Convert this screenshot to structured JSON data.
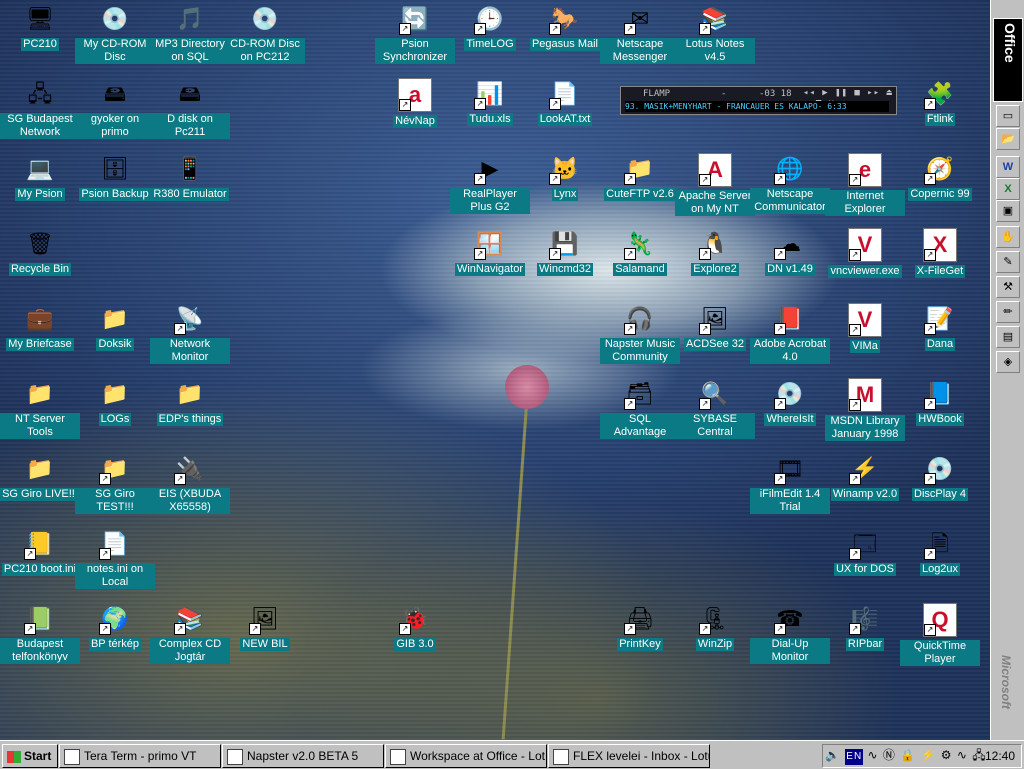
{
  "desktop": {
    "icons": [
      {
        "label": "PC210",
        "glyph": "🖥",
        "shortcut": false,
        "icon": "computer-icon"
      },
      {
        "label": "My CD-ROM Disc",
        "glyph": "💿",
        "shortcut": false,
        "icon": "cd-icon"
      },
      {
        "label": "MP3 Directory on SQL",
        "glyph": "🎵",
        "shortcut": false,
        "icon": "mp3-icon"
      },
      {
        "label": "CD-ROM Disc on PC212",
        "glyph": "💿",
        "shortcut": false,
        "icon": "cd-icon"
      },
      {
        "label": "Psion Synchronizer",
        "glyph": "🔄",
        "shortcut": true,
        "icon": "sync-icon"
      },
      {
        "label": "TimeLOG",
        "glyph": "🕒",
        "shortcut": true,
        "icon": "clock-icon"
      },
      {
        "label": "Pegasus Mail",
        "glyph": "🐎",
        "shortcut": true,
        "icon": "pegasus-icon"
      },
      {
        "label": "Netscape Messenger",
        "glyph": "✉",
        "shortcut": true,
        "icon": "messenger-icon"
      },
      {
        "label": "Lotus Notes v4.5",
        "glyph": "📚",
        "shortcut": true,
        "icon": "notes-icon"
      },
      {
        "label": "SG Budapest Network",
        "glyph": "🖧",
        "shortcut": false,
        "icon": "network-icon"
      },
      {
        "label": "gyoker on primo",
        "glyph": "🖴",
        "shortcut": false,
        "icon": "drive-icon"
      },
      {
        "label": "D disk on Pc211",
        "glyph": "🖴",
        "shortcut": false,
        "icon": "drive-icon"
      },
      {
        "label": "NévNap",
        "glyph": "a",
        "shortcut": true,
        "icon": "app-icon"
      },
      {
        "label": "Tudu.xls",
        "glyph": "📊",
        "shortcut": true,
        "icon": "excel-icon"
      },
      {
        "label": "LookAT.txt",
        "glyph": "📄",
        "shortcut": true,
        "icon": "text-file-icon"
      },
      {
        "label": "Ftlink",
        "glyph": "🧩",
        "shortcut": true,
        "icon": "ftlink-icon"
      },
      {
        "label": "My Psion",
        "glyph": "💻",
        "shortcut": false,
        "icon": "psion-icon"
      },
      {
        "label": "Psion Backup",
        "glyph": "🗄",
        "shortcut": false,
        "icon": "backup-icon"
      },
      {
        "label": "R380 Emulator",
        "glyph": "📱",
        "shortcut": false,
        "icon": "emulator-icon"
      },
      {
        "label": "RealPlayer Plus G2",
        "glyph": "▶",
        "shortcut": true,
        "icon": "realplayer-icon"
      },
      {
        "label": "Lynx",
        "glyph": "🐱",
        "shortcut": true,
        "icon": "lynx-icon"
      },
      {
        "label": "CuteFTP v2.6",
        "glyph": "📁",
        "shortcut": true,
        "icon": "ftp-icon"
      },
      {
        "label": "Apache Server on My NT",
        "glyph": "A",
        "shortcut": true,
        "icon": "apache-icon"
      },
      {
        "label": "Netscape Communicator",
        "glyph": "🌐",
        "shortcut": true,
        "icon": "netscape-icon"
      },
      {
        "label": "Internet Explorer",
        "glyph": "e",
        "shortcut": true,
        "icon": "ie-icon"
      },
      {
        "label": "Copernic 99",
        "glyph": "🧭",
        "shortcut": true,
        "icon": "copernic-icon"
      },
      {
        "label": "Recycle Bin",
        "glyph": "🗑",
        "shortcut": false,
        "icon": "recycle-bin-icon"
      },
      {
        "label": "WinNavigator",
        "glyph": "🪟",
        "shortcut": true,
        "icon": "winnavigator-icon"
      },
      {
        "label": "Wincmd32",
        "glyph": "💾",
        "shortcut": true,
        "icon": "wincmd-icon"
      },
      {
        "label": "Salamand",
        "glyph": "🦎",
        "shortcut": true,
        "icon": "salamand-icon"
      },
      {
        "label": "Explore2",
        "glyph": "🐧",
        "shortcut": true,
        "icon": "explore-icon"
      },
      {
        "label": "DN v1.49",
        "glyph": "☁",
        "shortcut": true,
        "icon": "dn-icon"
      },
      {
        "label": "vncviewer.exe",
        "glyph": "V",
        "shortcut": true,
        "icon": "vnc-icon"
      },
      {
        "label": "X-FileGet",
        "glyph": "X",
        "shortcut": true,
        "icon": "xfileget-icon"
      },
      {
        "label": "My Briefcase",
        "glyph": "💼",
        "shortcut": false,
        "icon": "briefcase-icon"
      },
      {
        "label": "Doksik",
        "glyph": "📁",
        "shortcut": false,
        "icon": "folder-icon"
      },
      {
        "label": "Network Monitor",
        "glyph": "📡",
        "shortcut": true,
        "icon": "monitor-icon"
      },
      {
        "label": "Napster Music Community",
        "glyph": "🎧",
        "shortcut": true,
        "icon": "napster-icon"
      },
      {
        "label": "ACDSee 32",
        "glyph": "🖼",
        "shortcut": true,
        "icon": "acdsee-icon"
      },
      {
        "label": "Adobe Acrobat 4.0",
        "glyph": "📕",
        "shortcut": true,
        "icon": "acrobat-icon"
      },
      {
        "label": "VIMa",
        "glyph": "V",
        "shortcut": true,
        "icon": "vim-icon"
      },
      {
        "label": "Dana",
        "glyph": "📝",
        "shortcut": true,
        "icon": "dana-icon"
      },
      {
        "label": "NT Server Tools",
        "glyph": "📁",
        "shortcut": false,
        "icon": "folder-icon"
      },
      {
        "label": "LOGs",
        "glyph": "📁",
        "shortcut": false,
        "icon": "folder-icon"
      },
      {
        "label": "EDP's things",
        "glyph": "📁",
        "shortcut": false,
        "icon": "folder-icon"
      },
      {
        "label": "SQL Advantage",
        "glyph": "🗃",
        "shortcut": true,
        "icon": "sql-icon"
      },
      {
        "label": "SYBASE Central",
        "glyph": "🔍",
        "shortcut": true,
        "icon": "sybase-icon"
      },
      {
        "label": "WhereIsIt",
        "glyph": "💿",
        "shortcut": true,
        "icon": "whereisit-icon"
      },
      {
        "label": "MSDN Library January 1998",
        "glyph": "M",
        "shortcut": true,
        "icon": "msdn-icon"
      },
      {
        "label": "HWBook",
        "glyph": "📘",
        "shortcut": true,
        "icon": "book-icon"
      },
      {
        "label": "SG Giro LIVE!!!",
        "glyph": "📁",
        "shortcut": false,
        "icon": "folder-icon"
      },
      {
        "label": "SG Giro TEST!!!",
        "glyph": "📁",
        "shortcut": true,
        "icon": "folder-icon"
      },
      {
        "label": "EIS (XBUDA X65558)",
        "glyph": "🔌",
        "shortcut": true,
        "icon": "eis-icon"
      },
      {
        "label": "iFilmEdit 1.4 Trial",
        "glyph": "🎞",
        "shortcut": true,
        "icon": "film-icon"
      },
      {
        "label": "Winamp v2.0",
        "glyph": "⚡",
        "shortcut": true,
        "icon": "winamp-icon"
      },
      {
        "label": "DiscPlay 4",
        "glyph": "💿",
        "shortcut": true,
        "icon": "discplay-icon"
      },
      {
        "label": "PC210 boot.ini",
        "glyph": "📒",
        "shortcut": true,
        "icon": "ini-file-icon"
      },
      {
        "label": "notes.ini on Local",
        "glyph": "📄",
        "shortcut": true,
        "icon": "ini-file-icon"
      },
      {
        "label": "UX for DOS",
        "glyph": "🗔",
        "shortcut": true,
        "icon": "dos-icon"
      },
      {
        "label": "Log2ux",
        "glyph": "🗎",
        "shortcut": true,
        "icon": "log-icon"
      },
      {
        "label": "Budapest telfonkönyv",
        "glyph": "📗",
        "shortcut": true,
        "icon": "phonebook-icon"
      },
      {
        "label": "BP térkép",
        "glyph": "🌍",
        "shortcut": true,
        "icon": "map-icon"
      },
      {
        "label": "Complex CD Jogtár",
        "glyph": "📚",
        "shortcut": true,
        "icon": "law-icon"
      },
      {
        "label": "NEW BIL",
        "glyph": "🖼",
        "shortcut": true,
        "icon": "bil-icon"
      },
      {
        "label": "GIB 3.0",
        "glyph": "🐞",
        "shortcut": true,
        "icon": "gib-icon"
      },
      {
        "label": "PrintKey",
        "glyph": "🖨",
        "shortcut": true,
        "icon": "printkey-icon"
      },
      {
        "label": "WinZip",
        "glyph": "🗜",
        "shortcut": true,
        "icon": "winzip-icon"
      },
      {
        "label": "Dial-Up Monitor",
        "glyph": "☎",
        "shortcut": true,
        "icon": "dialup-icon"
      },
      {
        "label": "RIPbar",
        "glyph": "🎼",
        "shortcut": true,
        "icon": "ripbar-icon"
      },
      {
        "label": "QuickTime Player",
        "glyph": "Q",
        "shortcut": true,
        "icon": "quicktime-icon"
      }
    ]
  },
  "flamp": {
    "title": "FLAMP",
    "dash": "-",
    "time": "-03 18",
    "controls": "◂◂ ▶ ❚❚ ■ ▸▸ ⏏ ─ ■ ✕",
    "track": "93. MASIK+MENYHART - FRANCAUER ES KALAPO-  6:33"
  },
  "officebar": {
    "label": "Office",
    "brand": "Microsoft"
  },
  "taskbar": {
    "start": "Start",
    "tasks": [
      {
        "label": "Tera Term - primo VT",
        "icon": "teraterm-icon"
      },
      {
        "label": "Napster v2.0 BETA 5",
        "icon": "napster-icon"
      },
      {
        "label": "Workspace at Office - Lot...",
        "icon": "lotus-icon"
      },
      {
        "label": "FLEX levelei - Inbox - Lotu...",
        "icon": "mail-icon"
      }
    ],
    "tray_lang": "EN",
    "clock": "12:40"
  }
}
